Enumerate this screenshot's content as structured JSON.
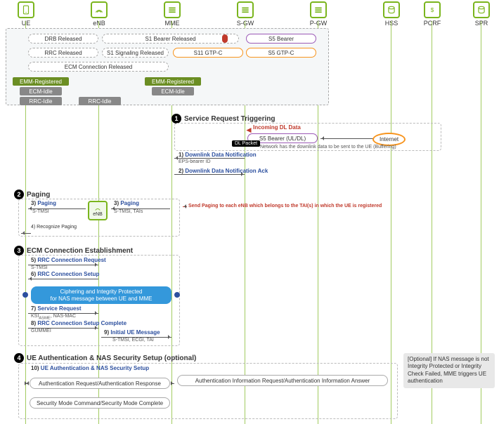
{
  "actors": {
    "ue": "UE",
    "enb": "eNB",
    "mme": "MME",
    "sgw": "S-GW",
    "pgw": "P-GW",
    "hss": "HSS",
    "pcrf": "PCRF",
    "spr": "SPR"
  },
  "bearers": {
    "drb": "DRB Released",
    "s1b": "S1 Bearer Released",
    "s5b": "S5 Bearer",
    "rrc": "RRC  Released",
    "s1sig": "S1 Signaling Released",
    "s11": "S11 GTP-C",
    "s5g": "S5 GTP-C",
    "ecm": "ECM Connection Released"
  },
  "states": {
    "emmr": "EMM-Registered",
    "ecmi": "ECM-Idle",
    "rrci": "RRC-Idle"
  },
  "s1": {
    "title": "Service Request Triggering",
    "incoming": "Incoming DL Data",
    "s5bearer": "S5 Bearer (UL/DL)",
    "internet": "Internet",
    "dlpkt": "DL Packet",
    "buffer": "Network has the downlink data to be sent to the UE (Buffering)",
    "m1": "Downlink Data Notification",
    "m1s": "EPS-bearer ID",
    "m2": "Downlink Data Notification Ack"
  },
  "s2": {
    "title": "Paging",
    "m3": "Paging",
    "m3s": "S-TMSI",
    "m3s2": "S-TMSI, TAIs",
    "m4": "Recognize Paging",
    "note": "Send Paging to each eNB which belongs to the TAI(s) in which the UE is registered",
    "enb": "eNB"
  },
  "s3": {
    "title": "ECM Connection Establishment",
    "m5": "RRC Connection Request",
    "m5s": "S-TMSI",
    "m6": "RRC Connection Setup",
    "banner": "Ciphering and Integrity Protected\nfor NAS message between UE and MME",
    "m7": "Service Request",
    "m7s": "KSIASME, NAS-MAC",
    "m8": "RRC Connection Setup Complete",
    "m8s": "GUMMEI",
    "m9": "Initial UE Message",
    "m9s": "S-TMSI, ECGI, TAI"
  },
  "s4": {
    "title": "UE Authentication & NAS Security Setup (optional)",
    "m10": "UE Authentication & NAS Security Setup",
    "r1": "Authentication Request/Authentication Response",
    "r2": "Authentication Information Request/Authentication Information Answer",
    "r3": "Security Mode Command/Security Mode Complete",
    "note": "[Optional] If NAS message is not Integrity Protected or Integrity Check Failed, MME triggers UE authentication"
  }
}
